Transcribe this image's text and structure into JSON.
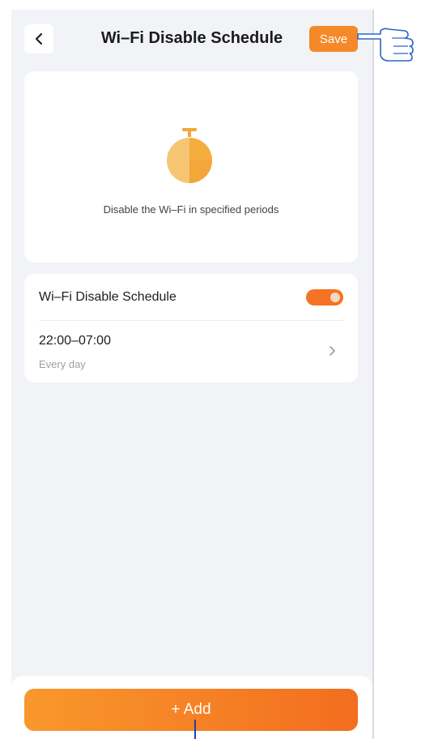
{
  "header": {
    "title": "Wi–Fi Disable Schedule",
    "save_label": "Save"
  },
  "illustration": {
    "icon": "stopwatch-icon",
    "description": "Disable the Wi–Fi in specified periods"
  },
  "settings": {
    "toggle_label": "Wi–Fi Disable Schedule",
    "toggle_on": true,
    "schedules": [
      {
        "time": "22:00–07:00",
        "repeat": "Every day"
      }
    ]
  },
  "footer": {
    "add_label": "+ Add"
  },
  "colors": {
    "accent": "#f5892a",
    "toggle": "#f47324",
    "background": "#f1f3f6"
  }
}
